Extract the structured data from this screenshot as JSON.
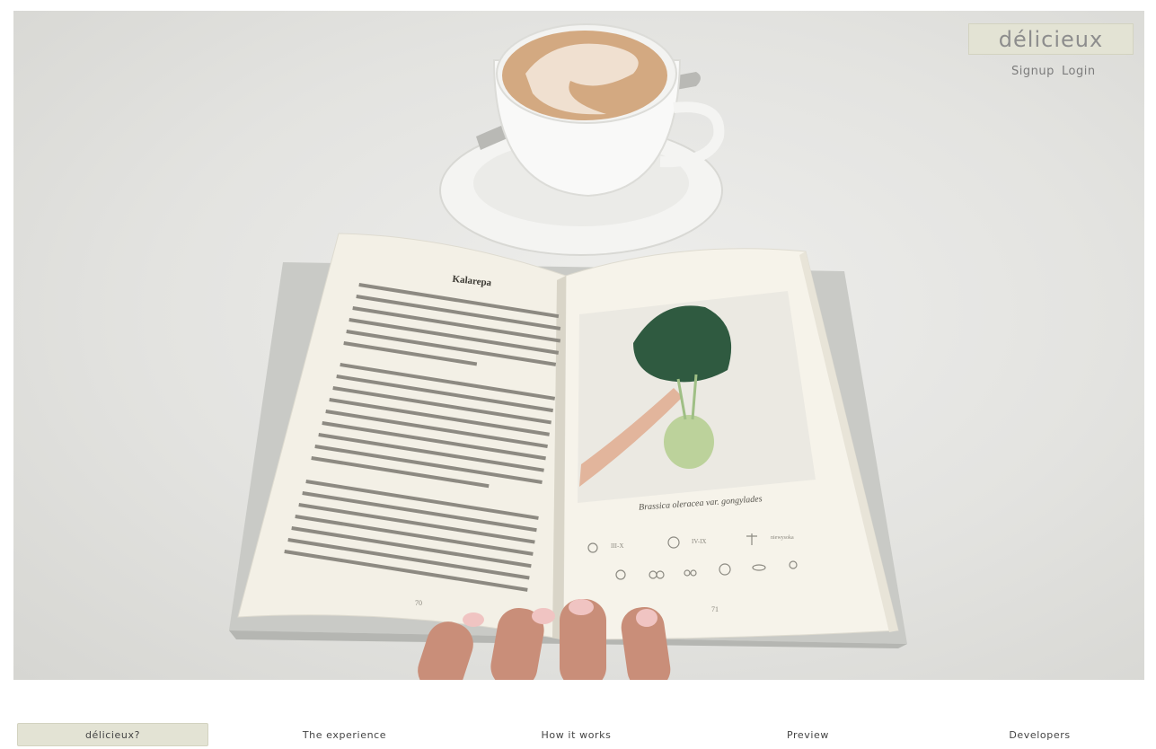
{
  "brand": {
    "name": "délicieux"
  },
  "auth": {
    "signup": "Signup",
    "login": "Login"
  },
  "book": {
    "left_title": "Kalarepa",
    "left_page_number": "70",
    "right_page_number": "71",
    "caption": "Brassica oleracea var. gongylades",
    "icon_labels": [
      "III-X",
      "IV-IX",
      "niewysoka"
    ]
  },
  "nav": {
    "items": [
      {
        "label": "délicieux?",
        "active": true
      },
      {
        "label": "The experience",
        "active": false
      },
      {
        "label": "How it works",
        "active": false
      },
      {
        "label": "Preview",
        "active": false
      },
      {
        "label": "Developers",
        "active": false
      }
    ]
  },
  "colors": {
    "accent": "#e3e3d4",
    "accent_border": "#d3d3c0",
    "nav_text": "#444444",
    "muted_text": "#7c7c7c"
  }
}
